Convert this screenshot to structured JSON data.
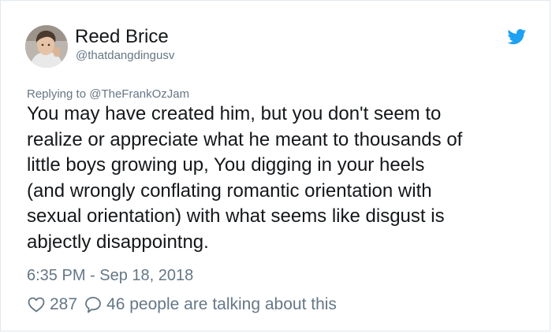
{
  "tweet": {
    "display_name": "Reed Brice",
    "handle": "@thatdangdingusv",
    "reply_prefix": "Replying to ",
    "reply_to": "@TheFrankOzJam",
    "text": "You may have created him, but you don't seem to\nrealize or appreciate what he meant to thousands of\nlittle boys growing up, You digging in your heels\n(and wrongly conflating romantic orientation with\nsexual orientation) with what seems like disgust is\nabjectly disappointng.",
    "timestamp": "6:35 PM - Sep 18, 2018",
    "likes": "287",
    "replies_text": "46 people are talking about this"
  },
  "icons": {
    "brand": "twitter-bird-icon",
    "like": "heart-icon",
    "reply": "speech-bubble-icon"
  },
  "colors": {
    "brand": "#1da1f2",
    "text": "#14171a",
    "secondary": "#657786",
    "border": "#e1e8ed"
  }
}
